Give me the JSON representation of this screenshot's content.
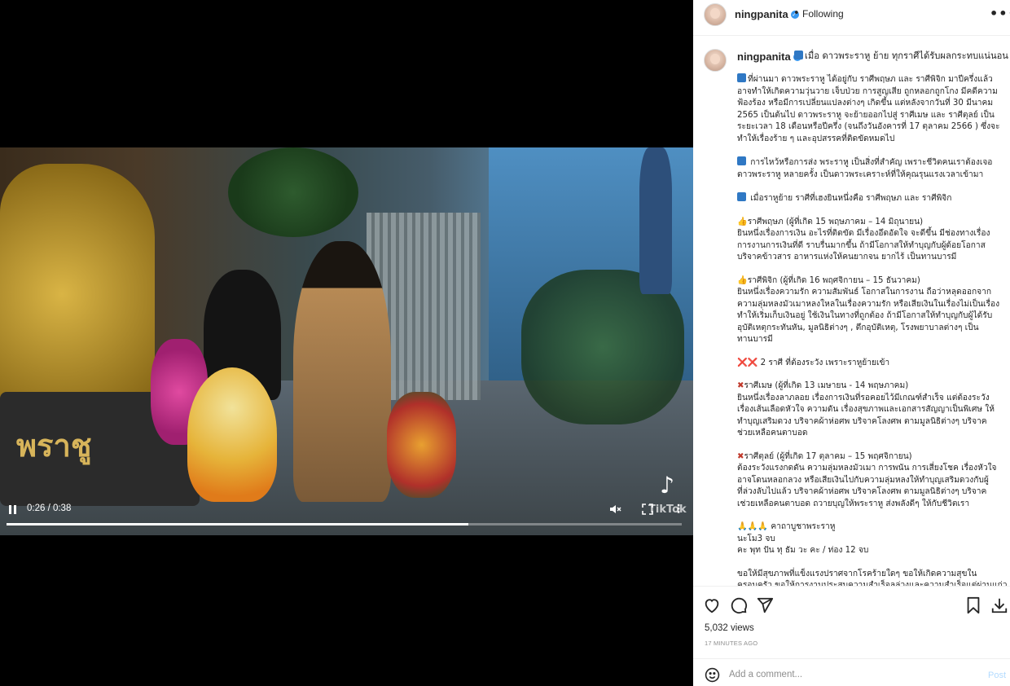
{
  "video": {
    "current_time": "0:26",
    "duration": "0:38",
    "time_display": "0:26 / 0:38",
    "progress_fraction": 0.684,
    "sign_text": "พราชู",
    "watermark": "TikTok",
    "muted": true
  },
  "header": {
    "username": "ningpanita",
    "separator": "•",
    "follow_status": "Following",
    "more_icon": "more-horizontal-icon"
  },
  "caption": {
    "username": "ningpanita",
    "title": "เมื่อ ดาวพระราหู ย้าย ทุกราศีได้รับผลกระทบแน่นอน !!",
    "paragraphs": [
      "ที่ผ่านมา ดาวพระราหู ได้อยู่กับ ราศีพฤษภ และ ราศีพิจิก มาปีครึ่งแล้ว\nอาจทำให้เกิดความวุ่นวาย เจ็บป่วย การสูญเสีย ถูกหลอกถูกโกง มีคดีความ\nฟ้องร้อง หรือมีการเปลี่ยนแปลงต่างๆ เกิดขึ้น แต่หลังจากวันที่ 30 มีนาคม\n2565 เป็นต้นไป ดาวพระราหู จะย้ายออกไปสู่ ราศีเมษ และ ราศีตุลย์ เป็น\nระยะเวลา 18 เดือนหรือปีครึ่ง (จนถึงวันอังคารที่ 17 ตุลาคม 2566 ) ซึ่งจะ\nทำให้เรื่องร้าย ๆ และอุปสรรคที่ติดขัดหมดไป",
      "การไหว้หรือการส่ง พระราหู เป็นสิ่งที่สำคัญ เพราะชีวิตคนเราต้องเจอ\nดาวพระราหู หลายครั้ง เป็นดาวพระเคราะห์ที่ให้คุณรุนแรงเวลาเข้ามา",
      "เมื่อราหูย้าย ราศีที่เฮงยินหนึ่งคือ ราศีพฤษภ และ ราศีพิจิก",
      "ราศีพฤษภ (ผู้ที่เกิด 15 พฤษภาคม – 14 มิถุนายน)\nยินหนึ่งเรื่องการเงิน อะไรที่ติดขัด มีเรื่องอึดอัดใจ จะดีขึ้น มีช่องทางเรื่อง\nการงานการเงินที่ดี ราบรื่นมากขึ้น ถ้ามีโอกาสให้ทำบุญกับผู้ด้อยโอกาส\nบริจาคข้าวสาร อาหารแห่งให้คนยากจน ยากไร้ เป็นทานบารมี",
      "ราศีพิจิก (ผู้ที่เกิด 16 พฤศจิกายน – 15 ธันวาคม)\nยินหนึ่งเรื่องความรัก ความสัมพันธ์ โอกาสในการงาน ถือว่าหลุดออกจาก\nความลุ่มหลงมัวเมาหลงใหลในเรื่องความรัก หรือเสียเงินในเรื่องไม่เป็นเรื่อง\nทำให้เริ่มเก็บเงินอยู่ ใช้เงินในทางที่ถูกต้อง ถ้ามีโอกาสให้ทำบุญกับผู้ได้รับ\nอุบัติเหตุกระทันหัน, มูลนิธิต่างๆ , ตึกอุบัติเหตุ, โรงพยาบาลต่างๆ เป็น\nทานบารมี",
      "2 ราศี ที่ต้องระวัง เพราะราหูย้ายเข้า",
      "ราศีเมษ (ผู้ที่เกิด 13 เมษายน - 14 พฤษภาคม)\nยินหนึ่งเรื่องลาภลอย เรื่องการเงินที่รอคอยไว้มีเกณฑ์สำเร็จ แต่ต้องระวัง\nเรื่องเส้นเลือดหัวใจ ความดัน เรื่องสุขภาพและเอกสารสัญญาเป็นพิเศษ ให้\nทำบุญเสริมดวง บริจาคผ้าห่อศพ บริจาคโลงศพ ตามมูลนิธิต่างๆ บริจาค\nช่วยเหลือคนตาบอด",
      "ราศีตุลย์ (ผู้ที่เกิด 17 ตุลาคม – 15 พฤศจิกายน)\nต้องระวังแรงกดดัน ความลุ่มหลงมัวเมา การพนัน การเสี่ยงโชค เรื่องหัวใจ\nอาจโดนหลอกลวง หรือเสียเงินไปกับความลุ่มหลงให้ทำบุญเสริมดวงกับผู้\nที่ล่วงลับไปแล้ว บริจาคผ้าห่อศพ บริจาคโลงศพ ตามมูลนิธิต่างๆ บริจาค\nเช่วยเหลือคนตาบอด ถวายบุญให้พระราหู ส่งพลังดีๆ ให้กับชีวิตเรา",
      "คาถาบูชาพระราหู\nนะโม3 จบ\nคะ พุท ปัน ทุ ธัม วะ คะ / ท่อง 12 จบ",
      "ขอให้มีสุขภาพที่แข็งแรงปราศจากโรคร้ายใดๆ ขอให้เกิดความสุขใน\nครอบครัว ขอให้การงานประสบความสำเร็จลุล่วงและความสำเร็จแต่ผ่านแก่ว"
    ],
    "prefix_icons": [
      "book-icon",
      "book-icon",
      "book-icon",
      "thumbs-up-icon",
      "thumbs-up-icon",
      "cross-mark-icon",
      "cross-mark-icon",
      "cross-mark-icon",
      "folded-hands-icon",
      ""
    ],
    "cross_prefix": "❌❌",
    "hands_prefix": "🙏🙏🙏"
  },
  "actions": {
    "views": "5,032 views",
    "time_ago": "17 MINUTES AGO"
  },
  "comment": {
    "placeholder": "Add a comment...",
    "post_label": "Post"
  },
  "colors": {
    "accent": "#3797f0",
    "post_disabled": "#b3dbff",
    "secondary_text": "#8e8e8e"
  }
}
